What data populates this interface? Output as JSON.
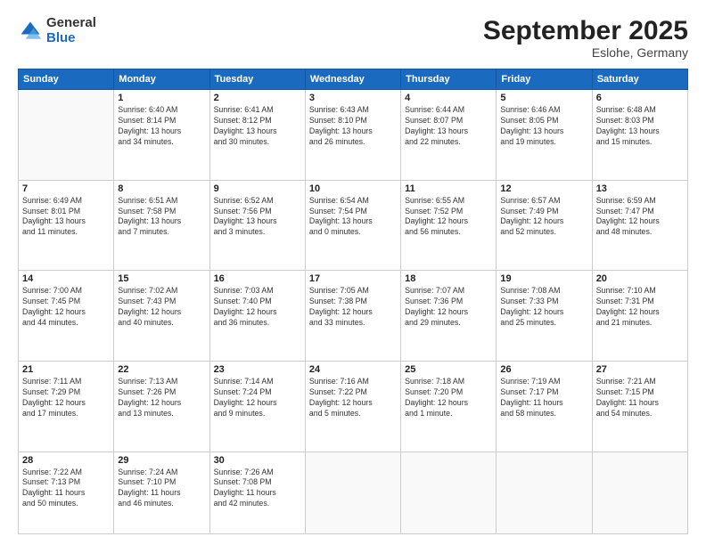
{
  "header": {
    "logo": {
      "general": "General",
      "blue": "Blue"
    },
    "title": "September 2025",
    "subtitle": "Eslohe, Germany"
  },
  "weekdays": [
    "Sunday",
    "Monday",
    "Tuesday",
    "Wednesday",
    "Thursday",
    "Friday",
    "Saturday"
  ],
  "weeks": [
    [
      {
        "day": "",
        "info": ""
      },
      {
        "day": "1",
        "info": "Sunrise: 6:40 AM\nSunset: 8:14 PM\nDaylight: 13 hours\nand 34 minutes."
      },
      {
        "day": "2",
        "info": "Sunrise: 6:41 AM\nSunset: 8:12 PM\nDaylight: 13 hours\nand 30 minutes."
      },
      {
        "day": "3",
        "info": "Sunrise: 6:43 AM\nSunset: 8:10 PM\nDaylight: 13 hours\nand 26 minutes."
      },
      {
        "day": "4",
        "info": "Sunrise: 6:44 AM\nSunset: 8:07 PM\nDaylight: 13 hours\nand 22 minutes."
      },
      {
        "day": "5",
        "info": "Sunrise: 6:46 AM\nSunset: 8:05 PM\nDaylight: 13 hours\nand 19 minutes."
      },
      {
        "day": "6",
        "info": "Sunrise: 6:48 AM\nSunset: 8:03 PM\nDaylight: 13 hours\nand 15 minutes."
      }
    ],
    [
      {
        "day": "7",
        "info": "Sunrise: 6:49 AM\nSunset: 8:01 PM\nDaylight: 13 hours\nand 11 minutes."
      },
      {
        "day": "8",
        "info": "Sunrise: 6:51 AM\nSunset: 7:58 PM\nDaylight: 13 hours\nand 7 minutes."
      },
      {
        "day": "9",
        "info": "Sunrise: 6:52 AM\nSunset: 7:56 PM\nDaylight: 13 hours\nand 3 minutes."
      },
      {
        "day": "10",
        "info": "Sunrise: 6:54 AM\nSunset: 7:54 PM\nDaylight: 13 hours\nand 0 minutes."
      },
      {
        "day": "11",
        "info": "Sunrise: 6:55 AM\nSunset: 7:52 PM\nDaylight: 12 hours\nand 56 minutes."
      },
      {
        "day": "12",
        "info": "Sunrise: 6:57 AM\nSunset: 7:49 PM\nDaylight: 12 hours\nand 52 minutes."
      },
      {
        "day": "13",
        "info": "Sunrise: 6:59 AM\nSunset: 7:47 PM\nDaylight: 12 hours\nand 48 minutes."
      }
    ],
    [
      {
        "day": "14",
        "info": "Sunrise: 7:00 AM\nSunset: 7:45 PM\nDaylight: 12 hours\nand 44 minutes."
      },
      {
        "day": "15",
        "info": "Sunrise: 7:02 AM\nSunset: 7:43 PM\nDaylight: 12 hours\nand 40 minutes."
      },
      {
        "day": "16",
        "info": "Sunrise: 7:03 AM\nSunset: 7:40 PM\nDaylight: 12 hours\nand 36 minutes."
      },
      {
        "day": "17",
        "info": "Sunrise: 7:05 AM\nSunset: 7:38 PM\nDaylight: 12 hours\nand 33 minutes."
      },
      {
        "day": "18",
        "info": "Sunrise: 7:07 AM\nSunset: 7:36 PM\nDaylight: 12 hours\nand 29 minutes."
      },
      {
        "day": "19",
        "info": "Sunrise: 7:08 AM\nSunset: 7:33 PM\nDaylight: 12 hours\nand 25 minutes."
      },
      {
        "day": "20",
        "info": "Sunrise: 7:10 AM\nSunset: 7:31 PM\nDaylight: 12 hours\nand 21 minutes."
      }
    ],
    [
      {
        "day": "21",
        "info": "Sunrise: 7:11 AM\nSunset: 7:29 PM\nDaylight: 12 hours\nand 17 minutes."
      },
      {
        "day": "22",
        "info": "Sunrise: 7:13 AM\nSunset: 7:26 PM\nDaylight: 12 hours\nand 13 minutes."
      },
      {
        "day": "23",
        "info": "Sunrise: 7:14 AM\nSunset: 7:24 PM\nDaylight: 12 hours\nand 9 minutes."
      },
      {
        "day": "24",
        "info": "Sunrise: 7:16 AM\nSunset: 7:22 PM\nDaylight: 12 hours\nand 5 minutes."
      },
      {
        "day": "25",
        "info": "Sunrise: 7:18 AM\nSunset: 7:20 PM\nDaylight: 12 hours\nand 1 minute."
      },
      {
        "day": "26",
        "info": "Sunrise: 7:19 AM\nSunset: 7:17 PM\nDaylight: 11 hours\nand 58 minutes."
      },
      {
        "day": "27",
        "info": "Sunrise: 7:21 AM\nSunset: 7:15 PM\nDaylight: 11 hours\nand 54 minutes."
      }
    ],
    [
      {
        "day": "28",
        "info": "Sunrise: 7:22 AM\nSunset: 7:13 PM\nDaylight: 11 hours\nand 50 minutes."
      },
      {
        "day": "29",
        "info": "Sunrise: 7:24 AM\nSunset: 7:10 PM\nDaylight: 11 hours\nand 46 minutes."
      },
      {
        "day": "30",
        "info": "Sunrise: 7:26 AM\nSunset: 7:08 PM\nDaylight: 11 hours\nand 42 minutes."
      },
      {
        "day": "",
        "info": ""
      },
      {
        "day": "",
        "info": ""
      },
      {
        "day": "",
        "info": ""
      },
      {
        "day": "",
        "info": ""
      }
    ]
  ]
}
